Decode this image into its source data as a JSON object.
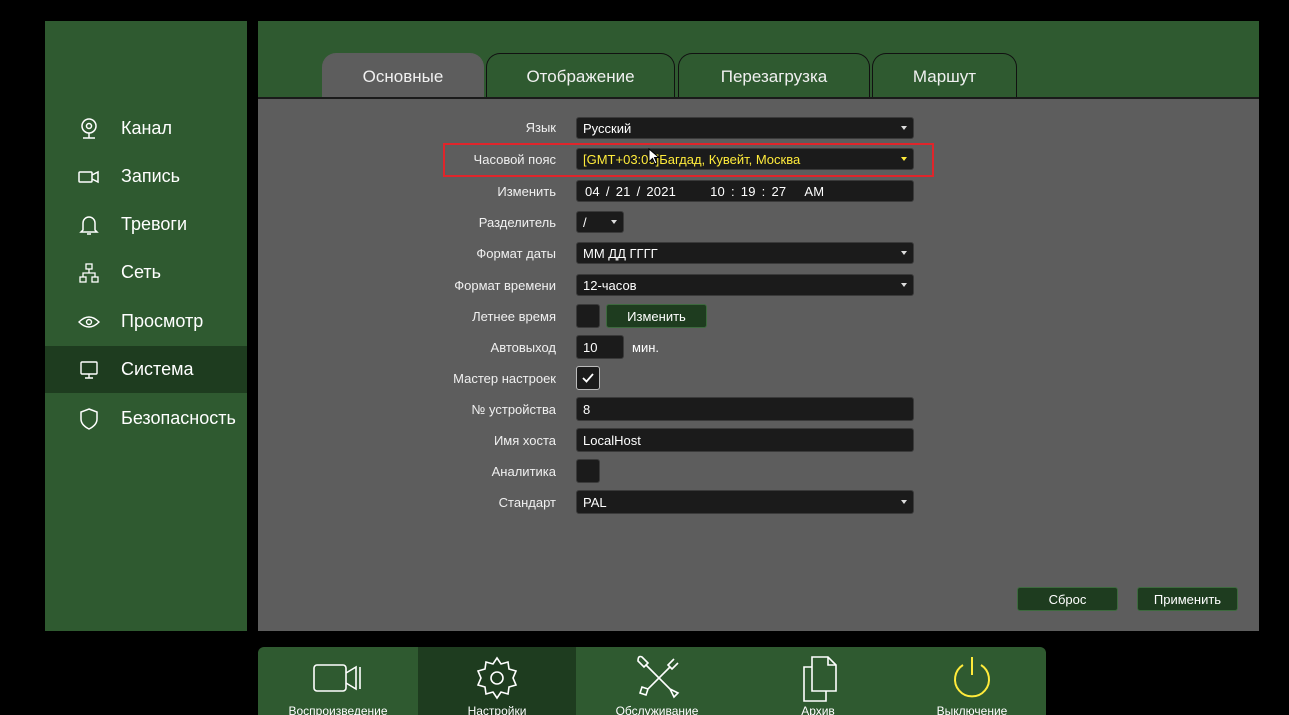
{
  "sidebar": {
    "items": [
      {
        "label": "Канал",
        "icon": "camera-lens-icon"
      },
      {
        "label": "Запись",
        "icon": "video-record-icon"
      },
      {
        "label": "Тревоги",
        "icon": "bell-icon"
      },
      {
        "label": "Сеть",
        "icon": "network-icon"
      },
      {
        "label": "Просмотр",
        "icon": "eye-icon"
      },
      {
        "label": "Система",
        "icon": "monitor-icon",
        "active": true
      },
      {
        "label": "Безопасность",
        "icon": "shield-icon"
      }
    ]
  },
  "tabs": [
    {
      "label": "Основные",
      "active": true
    },
    {
      "label": "Отображение"
    },
    {
      "label": "Перезагрузка"
    },
    {
      "label": "Маршут"
    }
  ],
  "form": {
    "language": {
      "label": "Язык",
      "value": "Русский"
    },
    "timezone": {
      "label": "Часовой пояс",
      "value": "[GMT+03:00]Багдад, Кувейт, Москва"
    },
    "datetime": {
      "label": "Изменить",
      "month": "04",
      "day": "21",
      "year": "2021",
      "hour": "10",
      "minute": "19",
      "second": "27",
      "ampm": "AM",
      "sep_date": "/",
      "sep_time": ":"
    },
    "separator": {
      "label": "Разделитель",
      "value": "/"
    },
    "date_format": {
      "label": "Формат даты",
      "value": "ММ ДД ГГГГ"
    },
    "time_format": {
      "label": "Формат времени",
      "value": "12-часов"
    },
    "dst": {
      "label": "Летнее время",
      "checked": false,
      "button": "Изменить"
    },
    "autologout": {
      "label": "Автовыход",
      "value": "10",
      "unit": "мин."
    },
    "wizard": {
      "label": "Мастер настроек",
      "checked": true
    },
    "device_no": {
      "label": "№ устройства",
      "value": "8"
    },
    "hostname": {
      "label": "Имя хоста",
      "value": "LocalHost"
    },
    "analytics": {
      "label": "Аналитика",
      "checked": false
    },
    "standard": {
      "label": "Стандарт",
      "value": "PAL"
    }
  },
  "actions": {
    "reset": "Сброс",
    "apply": "Применить"
  },
  "bottombar": {
    "items": [
      {
        "label": "Воспроизведение",
        "icon": "playback-camera-icon"
      },
      {
        "label": "Настройки",
        "icon": "settings-gear-icon",
        "active": true
      },
      {
        "label": "Обслуживание",
        "icon": "maintenance-tools-icon"
      },
      {
        "label": "Архив",
        "icon": "archive-files-icon"
      },
      {
        "label": "Выключение",
        "icon": "power-icon"
      }
    ]
  },
  "colors": {
    "accent_green": "#2f5a30",
    "active_green": "#1e3c1f",
    "highlight": "#ffeb3b",
    "alert_red": "#e0252b"
  }
}
